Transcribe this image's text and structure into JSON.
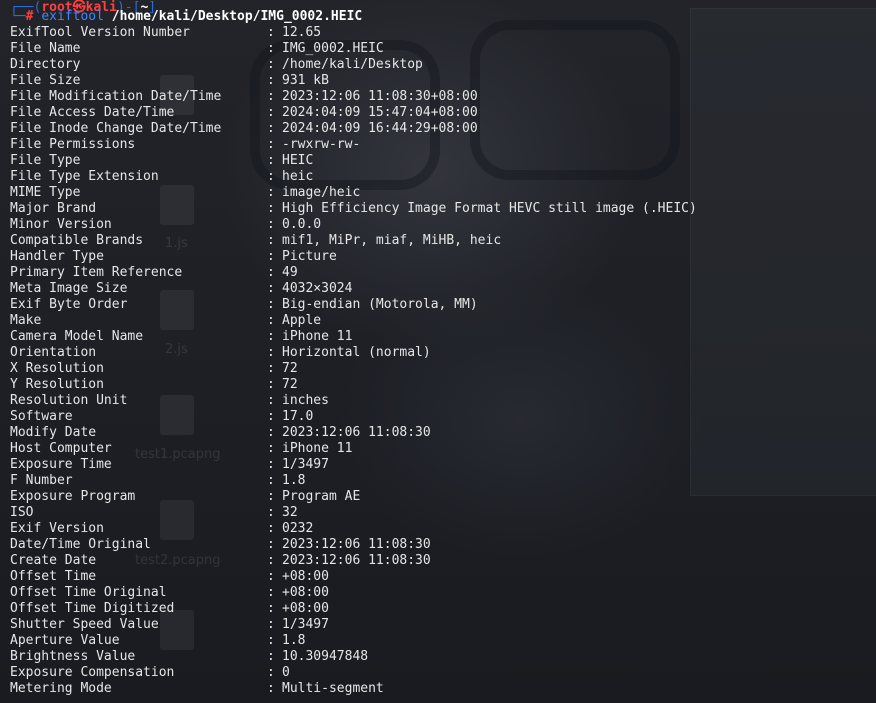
{
  "prompt": {
    "user": "root",
    "at_symbol": "㉿",
    "host": "kali",
    "cwd": "~",
    "hash": "#",
    "command": "exiftool",
    "argument": "/home/kali/Desktop/IMG_0002.HEIC"
  },
  "rows": [
    {
      "key": "ExifTool Version Number",
      "value": "12.65"
    },
    {
      "key": "File Name",
      "value": "IMG_0002.HEIC"
    },
    {
      "key": "Directory",
      "value": "/home/kali/Desktop"
    },
    {
      "key": "File Size",
      "value": "931 kB"
    },
    {
      "key": "File Modification Date/Time",
      "value": "2023:12:06 11:08:30+08:00"
    },
    {
      "key": "File Access Date/Time",
      "value": "2024:04:09 15:47:04+08:00"
    },
    {
      "key": "File Inode Change Date/Time",
      "value": "2024:04:09 16:44:29+08:00"
    },
    {
      "key": "File Permissions",
      "value": "-rwxrw-rw-"
    },
    {
      "key": "File Type",
      "value": "HEIC"
    },
    {
      "key": "File Type Extension",
      "value": "heic"
    },
    {
      "key": "MIME Type",
      "value": "image/heic"
    },
    {
      "key": "Major Brand",
      "value": "High Efficiency Image Format HEVC still image (.HEIC)"
    },
    {
      "key": "Minor Version",
      "value": "0.0.0"
    },
    {
      "key": "Compatible Brands",
      "value": "mif1, MiPr, miaf, MiHB, heic"
    },
    {
      "key": "Handler Type",
      "value": "Picture"
    },
    {
      "key": "Primary Item Reference",
      "value": "49"
    },
    {
      "key": "Meta Image Size",
      "value": "4032×3024"
    },
    {
      "key": "Exif Byte Order",
      "value": "Big-endian (Motorola, MM)"
    },
    {
      "key": "Make",
      "value": "Apple"
    },
    {
      "key": "Camera Model Name",
      "value": "iPhone 11"
    },
    {
      "key": "Orientation",
      "value": "Horizontal (normal)"
    },
    {
      "key": "X Resolution",
      "value": "72"
    },
    {
      "key": "Y Resolution",
      "value": "72"
    },
    {
      "key": "Resolution Unit",
      "value": "inches"
    },
    {
      "key": "Software",
      "value": "17.0"
    },
    {
      "key": "Modify Date",
      "value": "2023:12:06 11:08:30"
    },
    {
      "key": "Host Computer",
      "value": "iPhone 11"
    },
    {
      "key": "Exposure Time",
      "value": "1/3497"
    },
    {
      "key": "F Number",
      "value": "1.8"
    },
    {
      "key": "Exposure Program",
      "value": "Program AE"
    },
    {
      "key": "ISO",
      "value": "32"
    },
    {
      "key": "Exif Version",
      "value": "0232"
    },
    {
      "key": "Date/Time Original",
      "value": "2023:12:06 11:08:30"
    },
    {
      "key": "Create Date",
      "value": "2023:12:06 11:08:30"
    },
    {
      "key": "Offset Time",
      "value": "+08:00"
    },
    {
      "key": "Offset Time Original",
      "value": "+08:00"
    },
    {
      "key": "Offset Time Digitized",
      "value": "+08:00"
    },
    {
      "key": "Shutter Speed Value",
      "value": "1/3497"
    },
    {
      "key": "Aperture Value",
      "value": "1.8"
    },
    {
      "key": "Brightness Value",
      "value": "10.30947848"
    },
    {
      "key": "Exposure Compensation",
      "value": "0"
    },
    {
      "key": "Metering Mode",
      "value": "Multi-segment"
    }
  ],
  "separator": ":",
  "background_labels": {
    "desktop_file_1": "1.js",
    "desktop_file_2": "2.js",
    "desktop_file_3": "test1.pcapng",
    "desktop_file_4": "test2.pcapng"
  },
  "colors": {
    "prompt_frame": "#2f6ad9",
    "prompt_user": "#ff4040",
    "command": "#3f86ff",
    "text": "#e6e6e6",
    "background": "#1d1f25"
  }
}
